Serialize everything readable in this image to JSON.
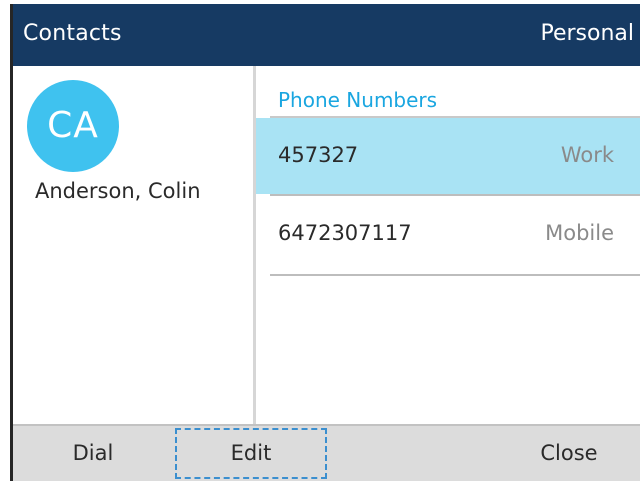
{
  "header": {
    "title": "Contacts",
    "directory": "Personal"
  },
  "contact": {
    "initials": "CA",
    "name": "Anderson, Colin"
  },
  "phone_section": {
    "label": "Phone Numbers",
    "numbers": [
      {
        "number": "457327",
        "type": "Work",
        "selected": true
      },
      {
        "number": "6472307117",
        "type": "Mobile",
        "selected": false
      }
    ]
  },
  "softkeys": {
    "dial": "Dial",
    "edit": "Edit",
    "close": "Close",
    "focused": "edit"
  },
  "colors": {
    "header_bg": "#163a63",
    "avatar_bg": "#3fc2ef",
    "accent_text": "#1aa6e0",
    "selected_row": "#a9e3f4",
    "softkey_bar": "#dcdcdc"
  }
}
